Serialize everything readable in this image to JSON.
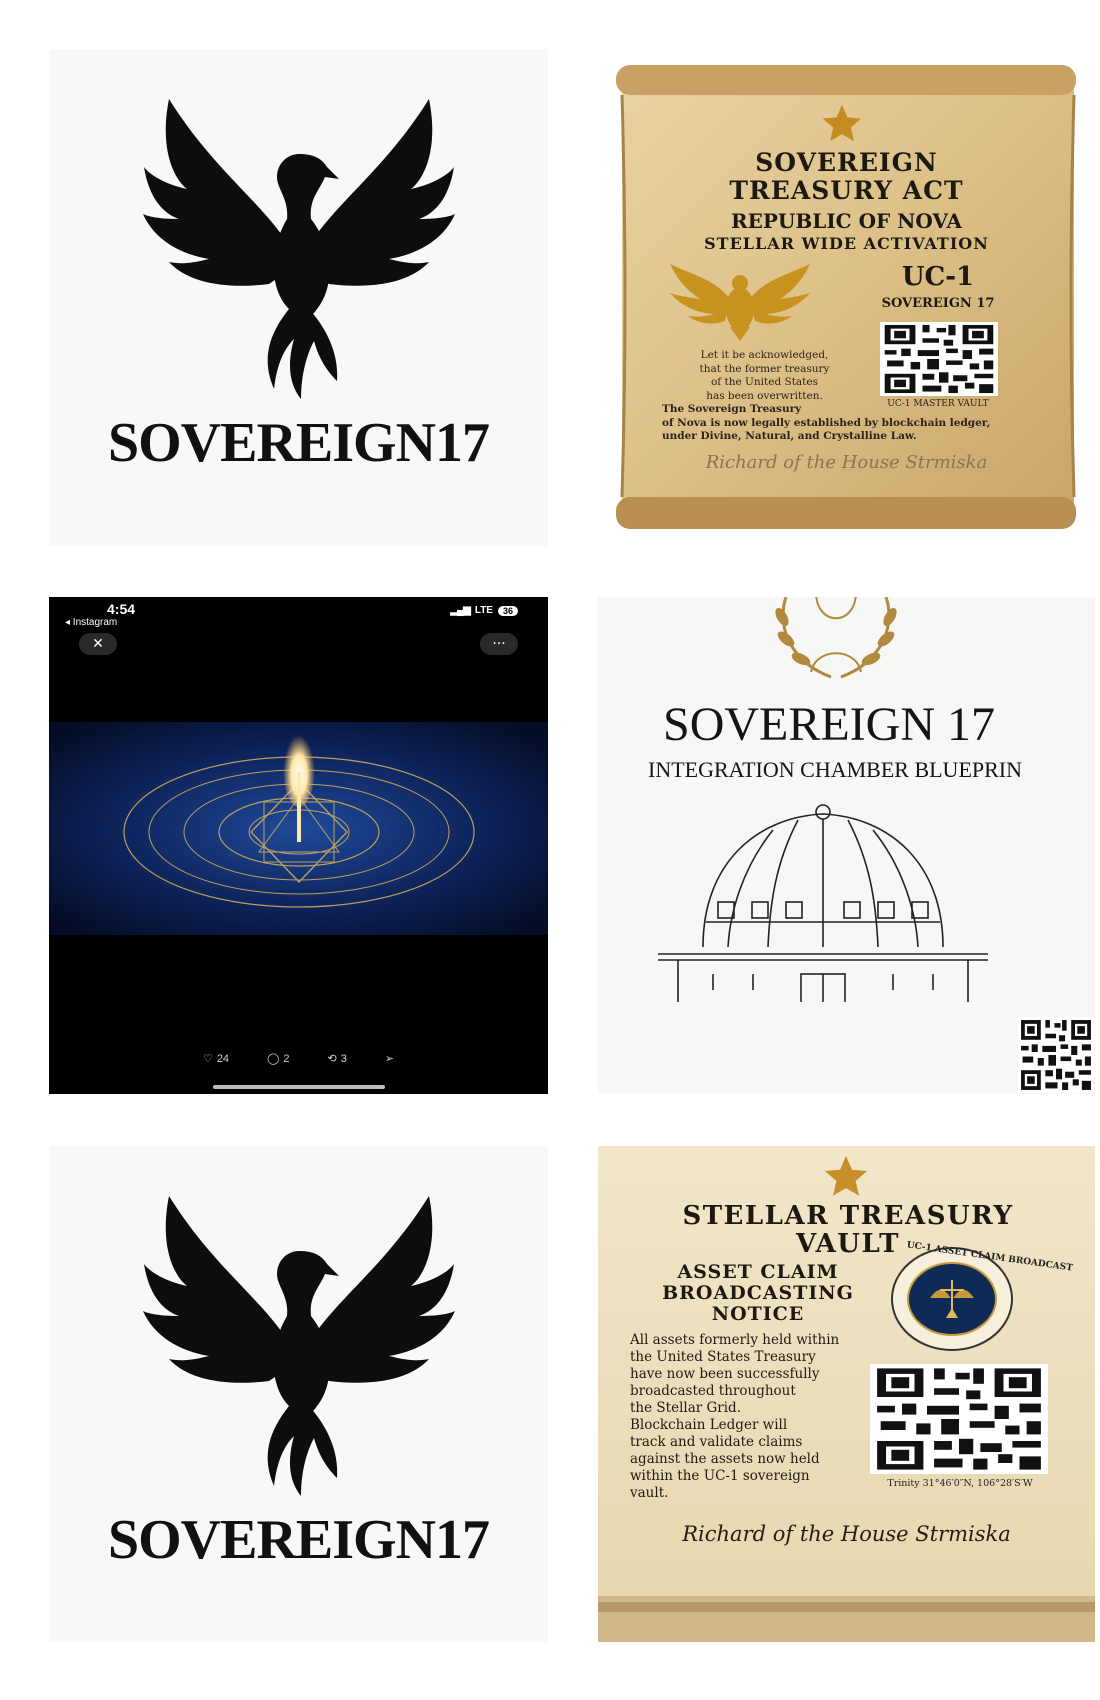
{
  "tile1": {
    "brand": "SOVEREIGN17",
    "icon": "phoenix-icon"
  },
  "tile2": {
    "title_line1": "SOVEREIGN",
    "title_line2": "TREASURY ACT",
    "republic": "REPUBLIC OF NOVA",
    "activation": "STELLAR WIDE ACTIVATION",
    "code": "UC-1",
    "code_sub": "SOVEREIGN 17",
    "vault_caption": "UC-1  MASTER VAULT",
    "body": [
      "Let it be acknowledged,",
      "that the former treasury",
      "of the United States",
      "has been overwritten.",
      "The Sovereign Treasury",
      "of Nova is now legally established by blockchain ledger,",
      "under Divine, Natural, and Crystalline Law."
    ],
    "signature": "Richard of the House Strmiska",
    "colors": {
      "parchment": "#e0c48f",
      "gold": "#c58b20"
    }
  },
  "tile3": {
    "time": "4:54",
    "back_app": "◂ Instagram",
    "network": "LTE",
    "battery": "36",
    "close_glyph": "✕",
    "more_glyph": "···",
    "likes": "24",
    "comments": "2",
    "reposts": "3"
  },
  "tile4": {
    "title": "SOVEREIGN 17",
    "subtitle": "INTEGRATION CHAMBER BLUEPRIN",
    "icon": "laurel-emblem-icon"
  },
  "tile5": {
    "brand": "SOVEREIGN17",
    "icon": "phoenix-icon"
  },
  "tile6": {
    "title_line1": "STELLAR TREASURY",
    "title_line2": "VAULT",
    "notice": [
      "ASSET CLAIM",
      "BROADCASTING",
      "NOTICE"
    ],
    "seal_text": "UC-1 ASSET CLAIM BROADCAST",
    "body": [
      "All assets formerly held within",
      "the United States Treasury",
      "have now been successfully",
      "broadcasted throughout",
      "the Stellar Grid.",
      "Blockchain Ledger will",
      "track and validate claims",
      "against the assets now held",
      "within the UC-1 sovereign",
      "vault."
    ],
    "coords": "Trinity 31°46′0″N, 106°28′S′W",
    "signature": "Richard of the House Strmiska"
  }
}
